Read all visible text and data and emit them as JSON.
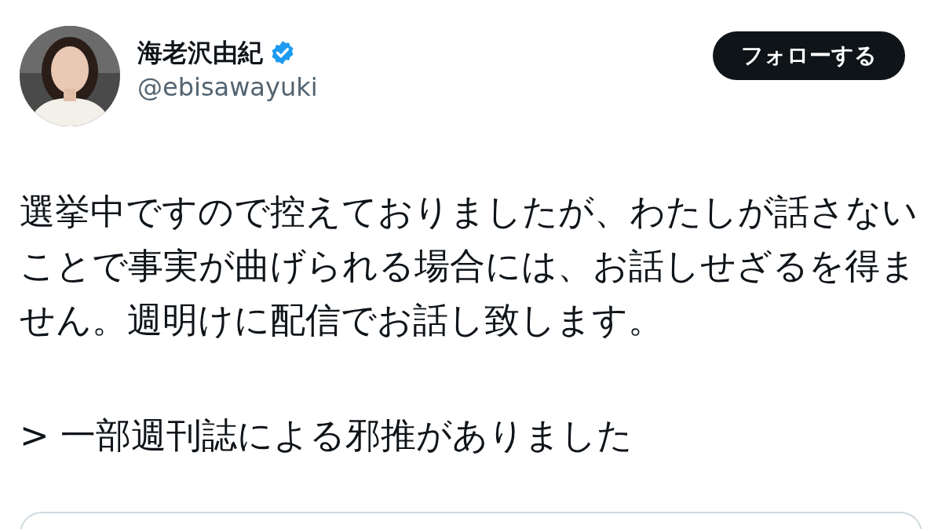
{
  "author": {
    "name": "海老沢由紀",
    "verified": true,
    "handle": "@ebisawayuki"
  },
  "follow_button": {
    "label": "フォローする"
  },
  "post": {
    "paragraphs": [
      "選挙中ですので控えておりましたが、わたしが話さないことで事実が曲げられる場合には、お話しせざるを得ません。週明けに配信でお話し致します。",
      "> 一部週刊誌による邪推がありました"
    ]
  }
}
